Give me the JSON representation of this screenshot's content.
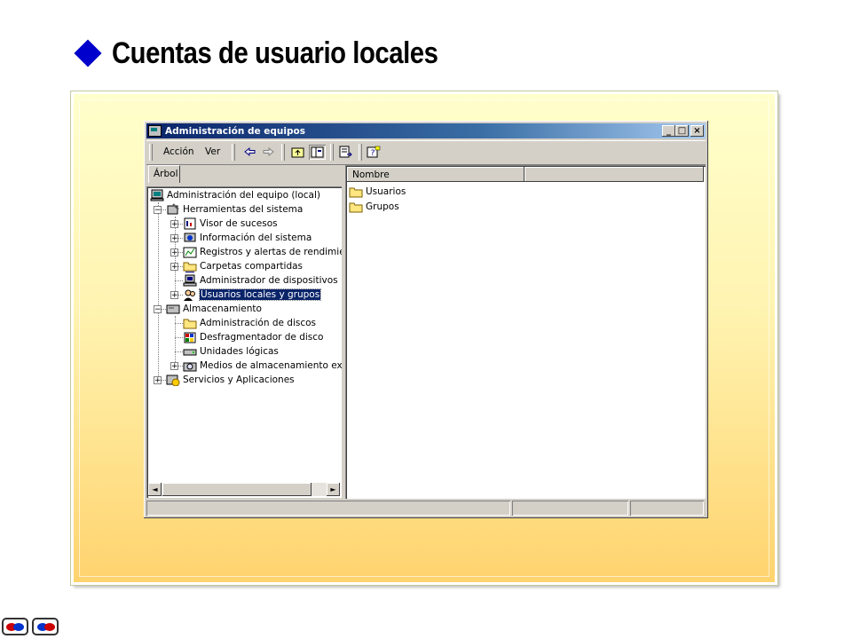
{
  "slide": {
    "title": "Cuentas de usuario locales",
    "bullet_color": "#0000cc"
  },
  "window": {
    "title": "Administración de equipos",
    "caption_buttons": {
      "minimize": "_",
      "maximize": "□",
      "close": "×"
    },
    "menu": {
      "accion": "Acción",
      "ver": "Ver"
    },
    "toolbar_icons": [
      "back-arrow-icon",
      "forward-arrow-icon",
      "up-folder-icon",
      "show-hide-tree-icon",
      "export-list-icon",
      "help-icon"
    ],
    "tab_label": "Árbol",
    "tree": [
      {
        "label": "Administración del equipo (local)",
        "icon": "computer-icon",
        "level": 0,
        "expander": ""
      },
      {
        "label": "Herramientas del sistema",
        "icon": "tools-icon",
        "level": 1,
        "expander": "−"
      },
      {
        "label": "Visor de sucesos",
        "icon": "event-viewer-icon",
        "level": 2,
        "expander": "+"
      },
      {
        "label": "Información del sistema",
        "icon": "system-info-icon",
        "level": 2,
        "expander": "+"
      },
      {
        "label": "Registros y alertas de rendimient",
        "icon": "performance-icon",
        "level": 2,
        "expander": "+"
      },
      {
        "label": "Carpetas compartidas",
        "icon": "shared-folder-icon",
        "level": 2,
        "expander": "+"
      },
      {
        "label": "Administrador de dispositivos",
        "icon": "device-manager-icon",
        "level": 2,
        "expander": ""
      },
      {
        "label": "Usuarios locales y grupos",
        "icon": "users-groups-icon",
        "level": 2,
        "expander": "+",
        "selected": true
      },
      {
        "label": "Almacenamiento",
        "icon": "storage-icon",
        "level": 1,
        "expander": "−"
      },
      {
        "label": "Administración de discos",
        "icon": "disk-management-icon",
        "level": 2,
        "expander": ""
      },
      {
        "label": "Desfragmentador de disco",
        "icon": "defrag-icon",
        "level": 2,
        "expander": ""
      },
      {
        "label": "Unidades lógicas",
        "icon": "logical-drive-icon",
        "level": 2,
        "expander": ""
      },
      {
        "label": "Medios de almacenamiento extrai",
        "icon": "removable-storage-icon",
        "level": 2,
        "expander": "+"
      },
      {
        "label": "Servicios y Aplicaciones",
        "icon": "services-icon",
        "level": 1,
        "expander": "+"
      }
    ],
    "list_columns": [
      "Nombre"
    ],
    "list_items": [
      {
        "label": "Usuarios",
        "icon": "folder-icon"
      },
      {
        "label": "Grupos",
        "icon": "folder-icon"
      }
    ],
    "scroll_arrows": {
      "left": "◄",
      "right": "►"
    }
  },
  "colors": {
    "titlebar_start": "#0a246a",
    "titlebar_end": "#a6caf0",
    "selection": "#0a246a",
    "frame_top": "#ffffcc",
    "frame_bottom": "#ffd36e"
  }
}
